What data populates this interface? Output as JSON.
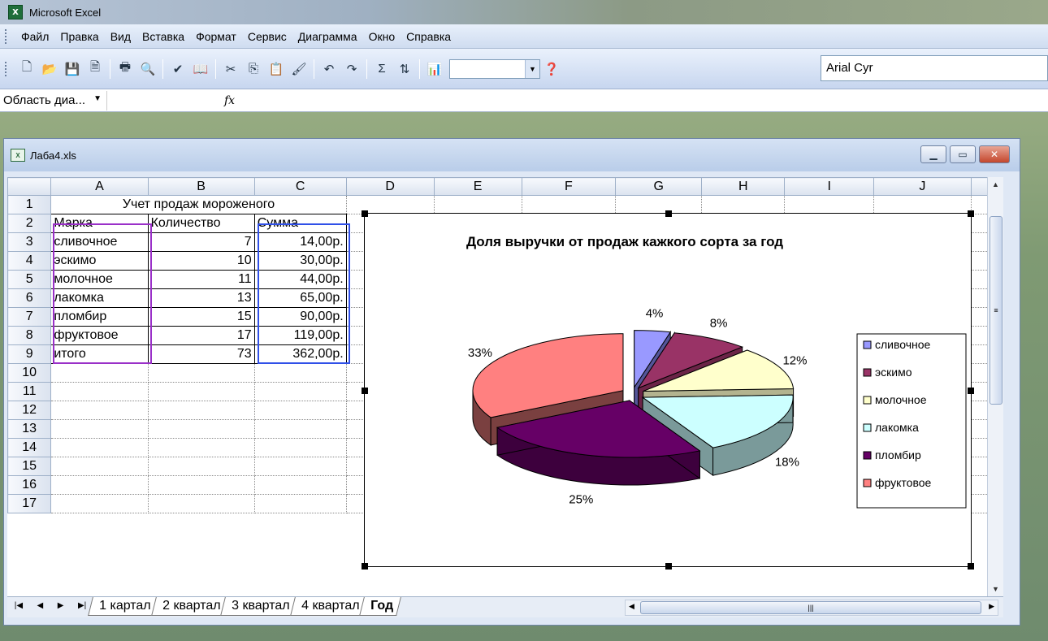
{
  "app": {
    "title": "Microsoft Excel"
  },
  "menu": {
    "items": [
      "Файл",
      "Правка",
      "Вид",
      "Вставка",
      "Формат",
      "Сервис",
      "Диаграмма",
      "Окно",
      "Справка"
    ]
  },
  "toolbar": {
    "font_name": "Arial Cyr"
  },
  "formula_bar": {
    "name_box": "Область диа...",
    "fx": "fx"
  },
  "workbook": {
    "title": "Лаба4.xls"
  },
  "columns": [
    "A",
    "B",
    "C",
    "D",
    "E",
    "F",
    "G",
    "H",
    "I",
    "J"
  ],
  "rows": [
    "1",
    "2",
    "3",
    "4",
    "5",
    "6",
    "7",
    "8",
    "9",
    "10",
    "11",
    "12",
    "13",
    "14",
    "15",
    "16",
    "17"
  ],
  "table": {
    "title": "Учет продаж мороженого",
    "headers": [
      "Марка",
      "Количество",
      "Сумма"
    ],
    "data": [
      [
        "сливочное",
        "7",
        "14,00р."
      ],
      [
        "эскимо",
        "10",
        "30,00р."
      ],
      [
        "молочное",
        "11",
        "44,00р."
      ],
      [
        "лакомка",
        "13",
        "65,00р."
      ],
      [
        "пломбир",
        "15",
        "90,00р."
      ],
      [
        "фруктовое",
        "17",
        "119,00р."
      ],
      [
        "итого",
        "73",
        "362,00р."
      ]
    ]
  },
  "sheet_tabs": [
    "1 картал",
    "2 квартал",
    "3 квартал",
    "4 квартал",
    "Год"
  ],
  "active_tab": "Год",
  "chart_data": {
    "type": "pie",
    "title": "Доля выручки от продаж кажкого сорта за год",
    "categories": [
      "сливочное",
      "эскимо",
      "молочное",
      "лакомка",
      "пломбир",
      "фруктовое"
    ],
    "values": [
      14,
      30,
      44,
      65,
      90,
      119
    ],
    "labels": [
      "4%",
      "8%",
      "12%",
      "18%",
      "25%",
      "33%"
    ],
    "colors": [
      "#9999ff",
      "#993366",
      "#ffffcc",
      "#ccffff",
      "#660066",
      "#ff8080"
    ],
    "side_colors": [
      "#555599",
      "#6b2447",
      "#b3b38f",
      "#7a9a9a",
      "#3d003d",
      "#7a4040"
    ],
    "legend_position": "right",
    "style": "3d-exploded"
  }
}
